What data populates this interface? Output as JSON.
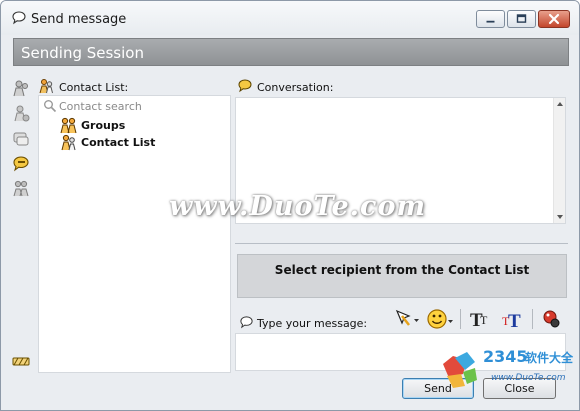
{
  "window": {
    "title": "Send message",
    "controls": {
      "minimize": "minimize",
      "maximize": "maximize",
      "close": "close"
    }
  },
  "session": {
    "title": "Sending Session"
  },
  "sidebar": {
    "icons": [
      "contacts-icon",
      "contacts-gray-icon",
      "chat-icon",
      "message-active-icon",
      "group-gray-icon",
      "conference-icon"
    ]
  },
  "contact_list": {
    "label": "Contact List:",
    "search_placeholder": "Contact search",
    "items": [
      {
        "label": "Groups",
        "icon": "groups-icon"
      },
      {
        "label": "Contact List",
        "icon": "contact-list-icon"
      }
    ]
  },
  "conversation": {
    "label": "Conversation:"
  },
  "recipient": {
    "text": "Select recipient from the Contact List"
  },
  "message": {
    "label": "Type your message:",
    "value": "",
    "tools": [
      "drawing-icon",
      "emoticon-icon",
      "text-format-icon",
      "text-color-icon",
      "attach-icon"
    ]
  },
  "buttons": {
    "send": "Send",
    "close": "Close"
  },
  "watermark": {
    "text": "www.DuoTe.com"
  },
  "corner_logo": {
    "brand": "2345软件大全",
    "url": "www.DuoTe.com"
  },
  "colors": {
    "session_header": "#9c9fa2",
    "send_border": "#3c7fb1",
    "close_red": "#c3462c"
  }
}
